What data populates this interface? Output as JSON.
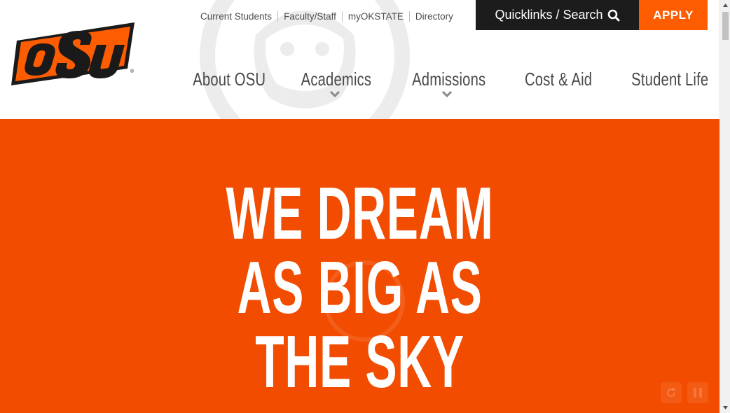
{
  "utility_nav": {
    "items": [
      {
        "label": "Current Students"
      },
      {
        "label": "Faculty/Staff"
      },
      {
        "label": "myOKSTATE"
      },
      {
        "label": "Directory"
      }
    ]
  },
  "quicklinks": {
    "label": "Quicklinks / Search",
    "icon": "search-icon"
  },
  "apply": {
    "label": "APPLY"
  },
  "main_nav": {
    "items": [
      {
        "label": "About OSU",
        "has_dropdown": false
      },
      {
        "label": "Academics",
        "has_dropdown": true
      },
      {
        "label": "Admissions",
        "has_dropdown": true
      },
      {
        "label": "Cost & Aid",
        "has_dropdown": false
      },
      {
        "label": "Student Life",
        "has_dropdown": false
      }
    ]
  },
  "hero": {
    "headline_lines": [
      "WE DREAM",
      "AS BIG AS",
      "THE SKY"
    ],
    "controls": [
      {
        "icon": "replay-icon"
      },
      {
        "icon": "pause-icon"
      }
    ]
  },
  "colors": {
    "brand_orange": "#f24c00",
    "apply_orange": "#fe5c00",
    "dark": "#1c1c1c",
    "nav_text": "#4a4a4a"
  }
}
